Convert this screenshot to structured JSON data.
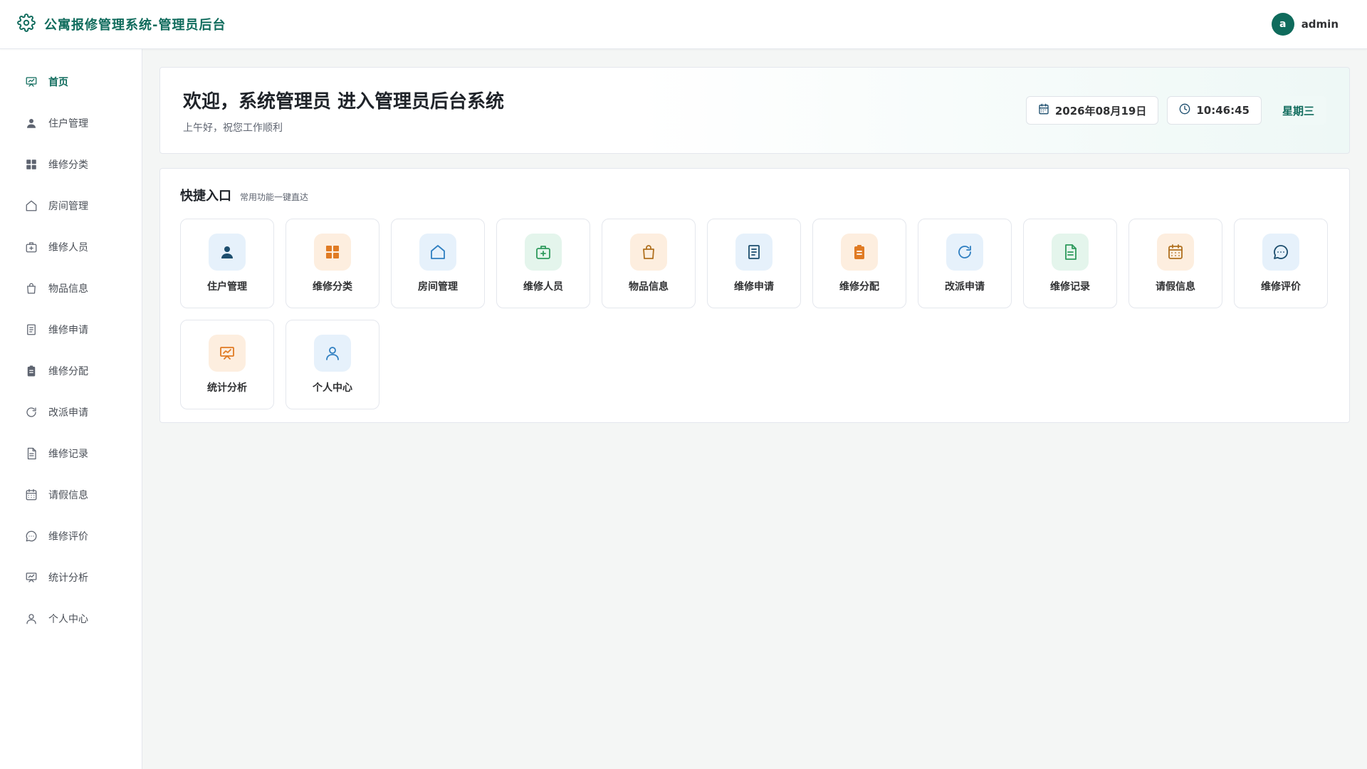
{
  "header": {
    "title": "公寓报修管理系统-管理员后台",
    "logo_icon": "gear-icon",
    "avatar_letter": "a",
    "username": "admin"
  },
  "sidebar": {
    "items": [
      {
        "label": "首页",
        "icon": "presentation-icon",
        "active": true
      },
      {
        "label": "住户管理",
        "icon": "user-icon"
      },
      {
        "label": "维修分类",
        "icon": "grid-icon"
      },
      {
        "label": "房间管理",
        "icon": "house-icon"
      },
      {
        "label": "维修人员",
        "icon": "medical-kit-icon"
      },
      {
        "label": "物品信息",
        "icon": "shopping-bag-icon"
      },
      {
        "label": "维修申请",
        "icon": "document-icon"
      },
      {
        "label": "维修分配",
        "icon": "clipboard-icon"
      },
      {
        "label": "改派申请",
        "icon": "refresh-icon"
      },
      {
        "label": "维修记录",
        "icon": "file-icon"
      },
      {
        "label": "请假信息",
        "icon": "calendar-icon"
      },
      {
        "label": "维修评价",
        "icon": "chat-icon"
      },
      {
        "label": "统计分析",
        "icon": "presentation-icon"
      },
      {
        "label": "个人中心",
        "icon": "user-outline-icon"
      }
    ]
  },
  "welcome": {
    "title": "欢迎，系统管理员 进入管理员后台系统",
    "subtitle": "上午好，祝您工作顺利",
    "date": "2026年08月19日",
    "time": "10:46:45",
    "weekday": "星期三"
  },
  "quick": {
    "title": "快捷入口",
    "subtitle": "常用功能一键直达",
    "items": [
      {
        "label": "住户管理",
        "icon": "user-icon",
        "tone": "blue",
        "color": "#1d4e6e"
      },
      {
        "label": "维修分类",
        "icon": "grid-icon",
        "tone": "orange",
        "color": "#e07b24"
      },
      {
        "label": "房间管理",
        "icon": "house-icon",
        "tone": "blue",
        "color": "#2f7fc1"
      },
      {
        "label": "维修人员",
        "icon": "medical-kit-icon",
        "tone": "green",
        "color": "#2e9a5c"
      },
      {
        "label": "物品信息",
        "icon": "shopping-bag-icon",
        "tone": "orange",
        "color": "#b0701f"
      },
      {
        "label": "维修申请",
        "icon": "document-icon",
        "tone": "blue",
        "color": "#1d4e6e"
      },
      {
        "label": "维修分配",
        "icon": "clipboard-icon",
        "tone": "orange",
        "color": "#e07b24"
      },
      {
        "label": "改派申请",
        "icon": "refresh-icon",
        "tone": "blue",
        "color": "#2f7fc1"
      },
      {
        "label": "维修记录",
        "icon": "file-icon",
        "tone": "green",
        "color": "#2e9a5c"
      },
      {
        "label": "请假信息",
        "icon": "calendar-icon",
        "tone": "orange",
        "color": "#b0701f"
      },
      {
        "label": "维修评价",
        "icon": "chat-icon",
        "tone": "blue",
        "color": "#1d4e6e"
      },
      {
        "label": "统计分析",
        "icon": "presentation-icon",
        "tone": "orange",
        "color": "#e07b24"
      },
      {
        "label": "个人中心",
        "icon": "user-outline-icon",
        "tone": "blue",
        "color": "#2f7fc1"
      }
    ]
  },
  "colors": {
    "brand": "#0f6b5c",
    "sidebar_icon": "#5e6470"
  }
}
